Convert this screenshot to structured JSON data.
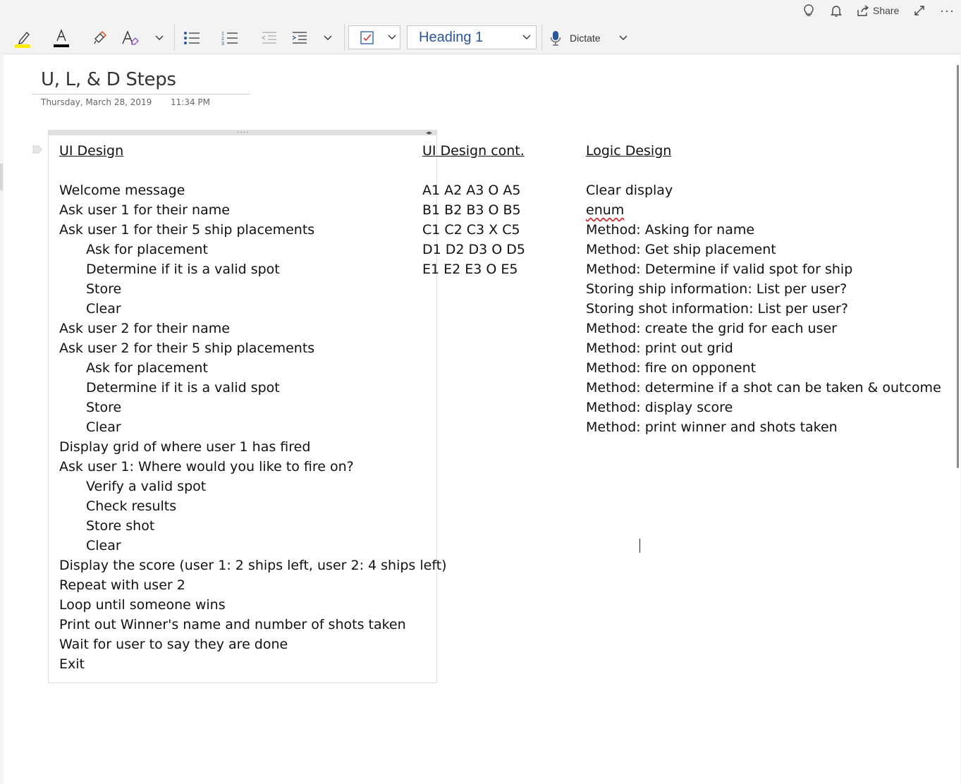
{
  "topbar": {
    "share_label": "Share"
  },
  "ribbon": {
    "style_value": "Heading 1",
    "dictate_label": "Dictate",
    "highlight_color": "#ffeb00",
    "font_color": "#000000",
    "accent_color": "#2b579a"
  },
  "page": {
    "title": "U, L, & D Steps",
    "date": "Thursday, March 28, 2019",
    "time": "11:34 PM"
  },
  "ui_design": {
    "heading": "UI Design",
    "lines": [
      {
        "text": "Welcome message",
        "indent": false
      },
      {
        "text": "Ask user 1 for their name",
        "indent": false
      },
      {
        "text": "Ask user 1 for their 5 ship placements",
        "indent": false
      },
      {
        "text": "Ask for placement",
        "indent": true
      },
      {
        "text": "Determine if it is a valid spot",
        "indent": true
      },
      {
        "text": "Store",
        "indent": true
      },
      {
        "text": "Clear",
        "indent": true
      },
      {
        "text": "Ask user 2 for their name",
        "indent": false
      },
      {
        "text": "Ask user 2 for their 5 ship placements",
        "indent": false
      },
      {
        "text": "Ask for placement",
        "indent": true
      },
      {
        "text": "Determine if it is a valid spot",
        "indent": true
      },
      {
        "text": "Store",
        "indent": true
      },
      {
        "text": "Clear",
        "indent": true
      },
      {
        "text": "Display grid of where user 1 has fired",
        "indent": false
      },
      {
        "text": "Ask user 1: Where would you like to fire on?",
        "indent": false
      },
      {
        "text": "Verify a valid spot",
        "indent": true
      },
      {
        "text": "Check results",
        "indent": true
      },
      {
        "text": "Store shot",
        "indent": true
      },
      {
        "text": "Clear",
        "indent": true
      },
      {
        "text": "Display the score (user 1: 2 ships left, user 2: 4 ships left)",
        "indent": false
      },
      {
        "text": "Repeat with user 2",
        "indent": false
      },
      {
        "text": "Loop until someone wins",
        "indent": false
      },
      {
        "text": "Print out Winner's name and number of shots taken",
        "indent": false
      },
      {
        "text": "Wait for user to say they are done",
        "indent": false
      },
      {
        "text": "Exit",
        "indent": false
      }
    ]
  },
  "ui_design_cont": {
    "heading": "UI Design cont.",
    "lines": [
      "A1 A2 A3 O A5",
      "B1 B2 B3 O B5",
      "C1 C2 C3 X C5",
      "D1 D2 D3 O D5",
      "E1 E2 E3 O E5"
    ]
  },
  "logic_design": {
    "heading": "Logic Design",
    "lines": [
      "Clear display",
      "enum",
      "Method: Asking for name",
      "Method: Get ship placement",
      "Method: Determine if valid spot for ship",
      "Storing ship information: List per user?",
      "Storing shot information: List per user?",
      "Method: create the grid for each user",
      "Method: print out grid",
      "Method: fire on opponent",
      "Method: determine if a shot can be taken & outcome",
      "Method: display score",
      "Method: print winner and shots taken"
    ]
  }
}
